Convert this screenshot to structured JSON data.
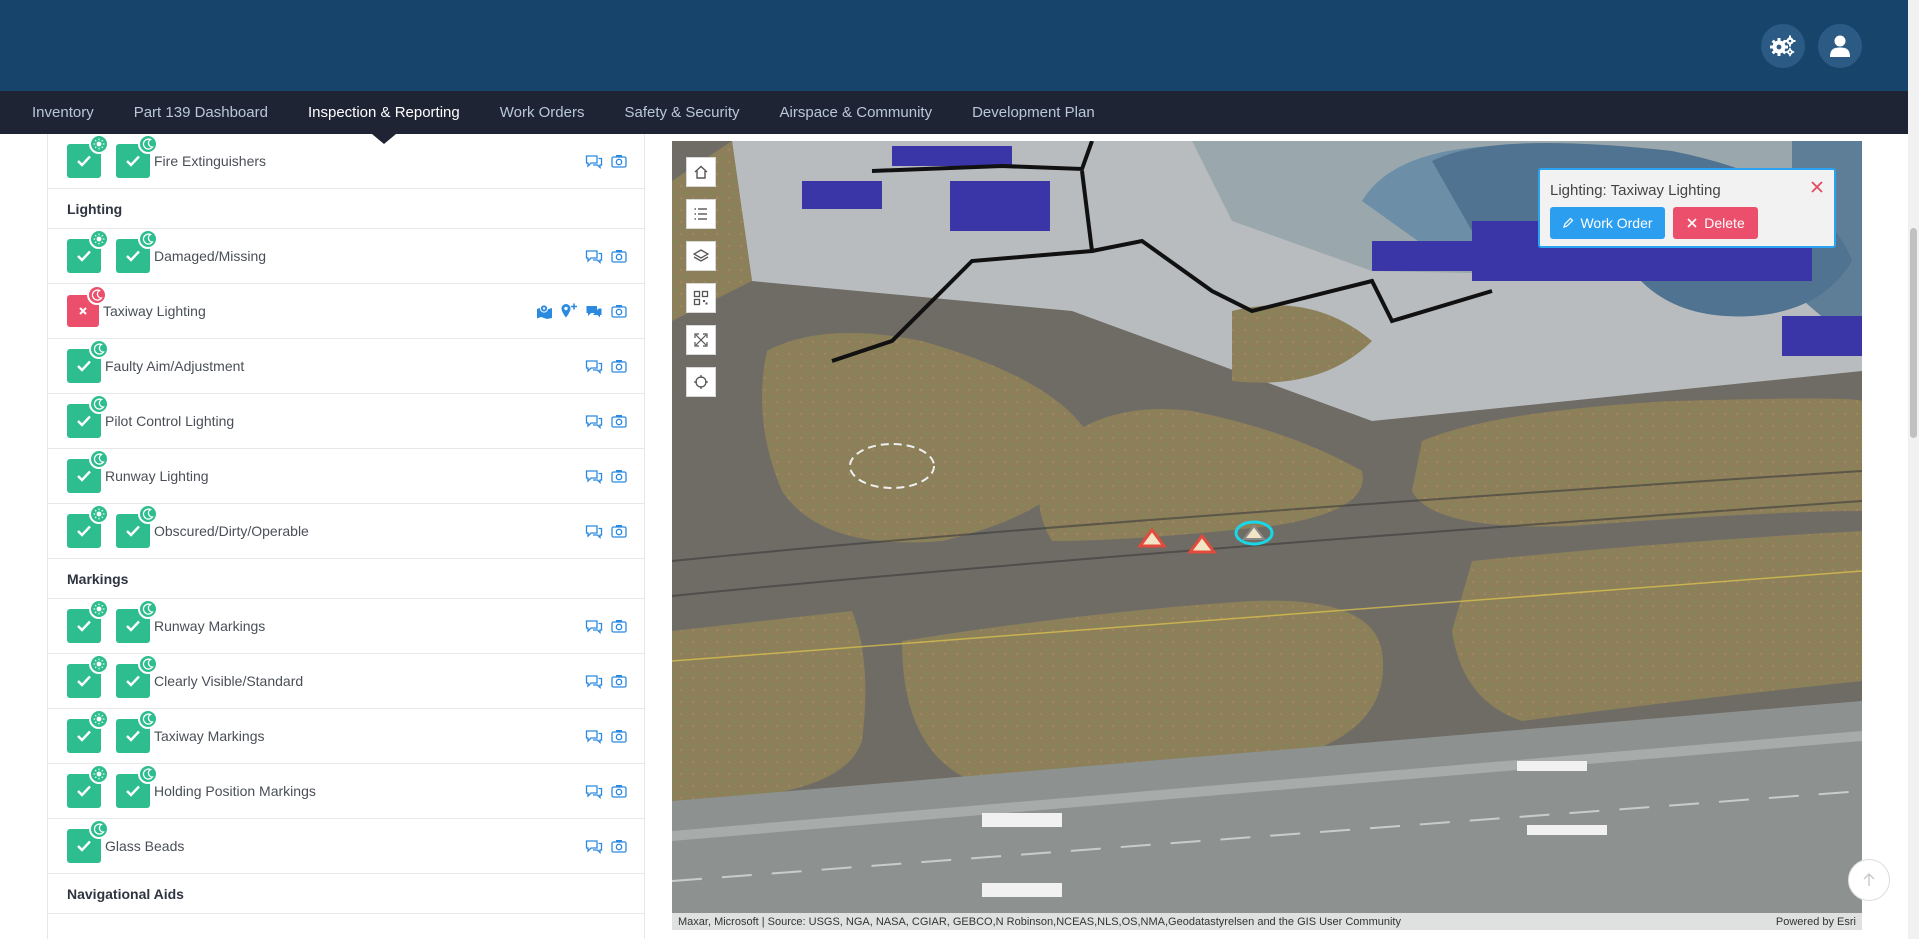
{
  "nav": {
    "items": [
      "Inventory",
      "Part 139 Dashboard",
      "Inspection & Reporting",
      "Work Orders",
      "Safety & Security",
      "Airspace & Community",
      "Development Plan"
    ],
    "active": "Inspection & Reporting"
  },
  "header": {
    "settings_icon": "gears-icon",
    "user_icon": "user-icon"
  },
  "checklist": {
    "rows": [
      {
        "type": "item",
        "label": "Fire Extinguishers",
        "checks": [
          "pass-day",
          "pass-night"
        ],
        "actions": [
          "comment",
          "camera"
        ]
      },
      {
        "type": "section",
        "label": "Lighting"
      },
      {
        "type": "item",
        "label": "Damaged/Missing",
        "checks": [
          "pass-day",
          "pass-night"
        ],
        "actions": [
          "comment",
          "camera"
        ]
      },
      {
        "type": "item",
        "label": "Taxiway Lighting",
        "checks": [
          "fail-night"
        ],
        "actions": [
          "map",
          "add-location",
          "comments",
          "camera"
        ]
      },
      {
        "type": "item",
        "label": "Faulty Aim/Adjustment",
        "checks": [
          "pass-night"
        ],
        "actions": [
          "comment",
          "camera"
        ]
      },
      {
        "type": "item",
        "label": "Pilot Control Lighting",
        "checks": [
          "pass-night"
        ],
        "actions": [
          "comment",
          "camera"
        ]
      },
      {
        "type": "item",
        "label": "Runway Lighting",
        "checks": [
          "pass-night"
        ],
        "actions": [
          "comment",
          "camera"
        ]
      },
      {
        "type": "item",
        "label": "Obscured/Dirty/Operable",
        "checks": [
          "pass-day",
          "pass-night"
        ],
        "actions": [
          "comment",
          "camera"
        ]
      },
      {
        "type": "section",
        "label": "Markings"
      },
      {
        "type": "item",
        "label": "Runway Markings",
        "checks": [
          "pass-day",
          "pass-night"
        ],
        "actions": [
          "comment",
          "camera"
        ]
      },
      {
        "type": "item",
        "label": "Clearly Visible/Standard",
        "checks": [
          "pass-day",
          "pass-night"
        ],
        "actions": [
          "comment",
          "camera"
        ]
      },
      {
        "type": "item",
        "label": "Taxiway Markings",
        "checks": [
          "pass-day",
          "pass-night"
        ],
        "actions": [
          "comment",
          "camera"
        ]
      },
      {
        "type": "item",
        "label": "Holding Position Markings",
        "checks": [
          "pass-day",
          "pass-night"
        ],
        "actions": [
          "comment",
          "camera"
        ]
      },
      {
        "type": "item",
        "label": "Glass Beads",
        "checks": [
          "pass-night"
        ],
        "actions": [
          "comment",
          "camera"
        ]
      },
      {
        "type": "section",
        "label": "Navigational Aids"
      }
    ]
  },
  "map": {
    "tools": [
      "home-icon",
      "list-icon",
      "layers-icon",
      "qr-icon",
      "expand-icon",
      "locate-icon"
    ],
    "popup": {
      "title": "Lighting: Taxiway Lighting",
      "work_order": "Work Order",
      "delete": "Delete"
    },
    "attribution": "Maxar, Microsoft | Source: USGS, NGA, NASA, CGIAR, GEBCO,N Robinson,NCEAS,NLS,OS,NMA,Geodatastyrelsen and the GIS User Community",
    "powered_by": "Powered by Esri"
  },
  "colors": {
    "header": "#17446b",
    "nav": "#1e2434",
    "pass": "#2ebd8e",
    "fail": "#ec4f6c",
    "link": "#2b8ae0",
    "building": "#3b36a8"
  }
}
